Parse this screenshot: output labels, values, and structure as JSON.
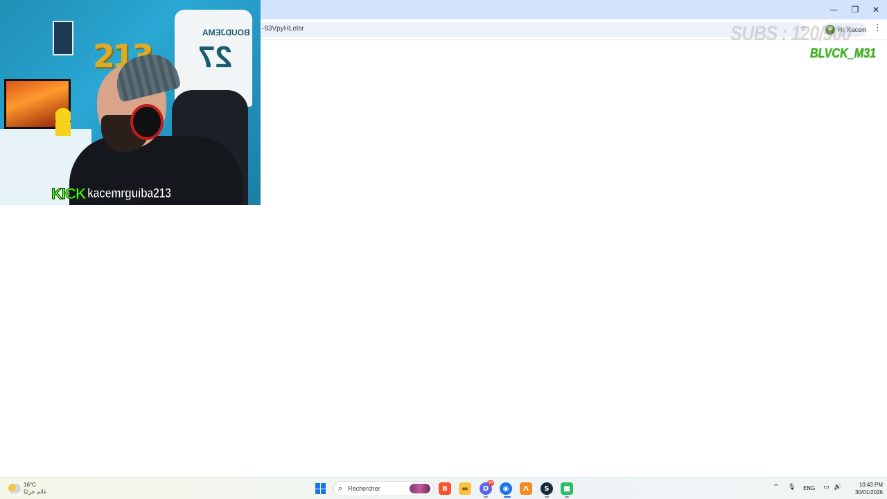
{
  "browser": {
    "url_visible": "-93VpyHLelsr",
    "profile_label": "Hi, Kacem",
    "window_controls": {
      "minimize": "—",
      "restore": "❐",
      "close": "✕"
    },
    "star_icon": "star-icon",
    "menu_icon": "kebab-menu-icon"
  },
  "overlay": {
    "subs_counter": "SUBS : 120/500",
    "streamer_tag": "BLVCK_M31"
  },
  "webcam": {
    "balloon_text": "213",
    "jersey_name": "BOUDJEMA",
    "jersey_number": "27",
    "kick_logo": "KICK",
    "kick_username": "kacemrguiba213"
  },
  "taskbar": {
    "weather": {
      "temp": "16°C",
      "desc": "غائم جزئيًا"
    },
    "search_placeholder": "Rechercher",
    "pinned_apps": [
      {
        "name": "brave",
        "color": "#fb542b",
        "glyph": "B"
      },
      {
        "name": "file-explorer",
        "color": "#f6c343",
        "glyph": "▬"
      },
      {
        "name": "discord",
        "color": "#5865f2",
        "glyph": "D",
        "badge": "99"
      },
      {
        "name": "chrome",
        "color": "#1a73e8",
        "glyph": "◉"
      },
      {
        "name": "app-orange",
        "color": "#f28b22",
        "glyph": "Λ"
      },
      {
        "name": "steam",
        "color": "#1b2838",
        "glyph": "S"
      },
      {
        "name": "app-green",
        "color": "#2bbf6a",
        "glyph": "■"
      }
    ],
    "tray": {
      "chevron": "^",
      "mic": "🎙",
      "lang": "ENG",
      "monitor": "▭",
      "volume": "🔊",
      "time": "10:43 PM",
      "date": "30/01/2026"
    }
  }
}
